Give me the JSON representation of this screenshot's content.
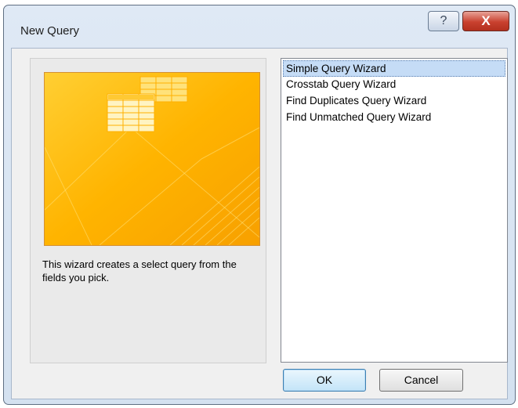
{
  "window": {
    "title": "New Query",
    "help_label": "?",
    "close_label": "X"
  },
  "preview": {
    "description": "This wizard creates a select query from the fields you pick."
  },
  "wizards": {
    "items": [
      {
        "label": "Simple Query Wizard",
        "selected": true
      },
      {
        "label": "Crosstab Query Wizard",
        "selected": false
      },
      {
        "label": "Find Duplicates Query Wizard",
        "selected": false
      },
      {
        "label": "Find Unmatched Query Wizard",
        "selected": false
      }
    ]
  },
  "buttons": {
    "ok_label": "OK",
    "cancel_label": "Cancel"
  },
  "colors": {
    "preview_orange": "#f7a800",
    "preview_yellow": "#ffd84d",
    "selection": "#c5dcf6"
  }
}
